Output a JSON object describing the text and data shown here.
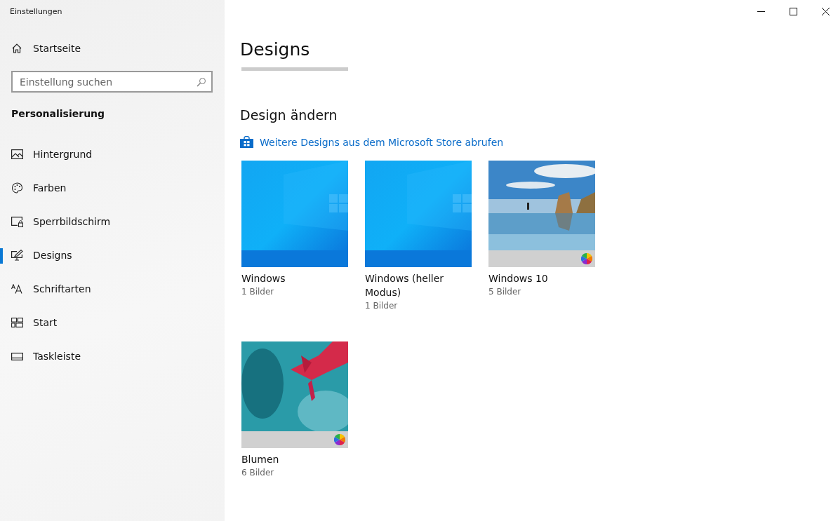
{
  "window": {
    "title": "Einstellungen"
  },
  "sidebar": {
    "home": "Startseite",
    "search": {
      "placeholder": "Einstellung suchen"
    },
    "section": "Personalisierung",
    "items": [
      {
        "label": "Hintergrund",
        "selected": false
      },
      {
        "label": "Farben",
        "selected": false
      },
      {
        "label": "Sperrbildschirm",
        "selected": false
      },
      {
        "label": "Designs",
        "selected": true
      },
      {
        "label": "Schriftarten",
        "selected": false
      },
      {
        "label": "Start",
        "selected": false
      },
      {
        "label": "Taskleiste",
        "selected": false
      }
    ]
  },
  "page": {
    "title": "Designs",
    "section": "Design ändern",
    "store_link": "Weitere Designs aus dem Microsoft Store abrufen",
    "themes": [
      {
        "name": "Windows",
        "count": "1 Bilder",
        "kind": "windows"
      },
      {
        "name": "Windows (heller Modus)",
        "count": "1 Bilder",
        "kind": "windows"
      },
      {
        "name": "Windows 10",
        "count": "5 Bilder",
        "kind": "beach"
      },
      {
        "name": "Blumen",
        "count": "6 Bilder",
        "kind": "flower"
      }
    ]
  }
}
